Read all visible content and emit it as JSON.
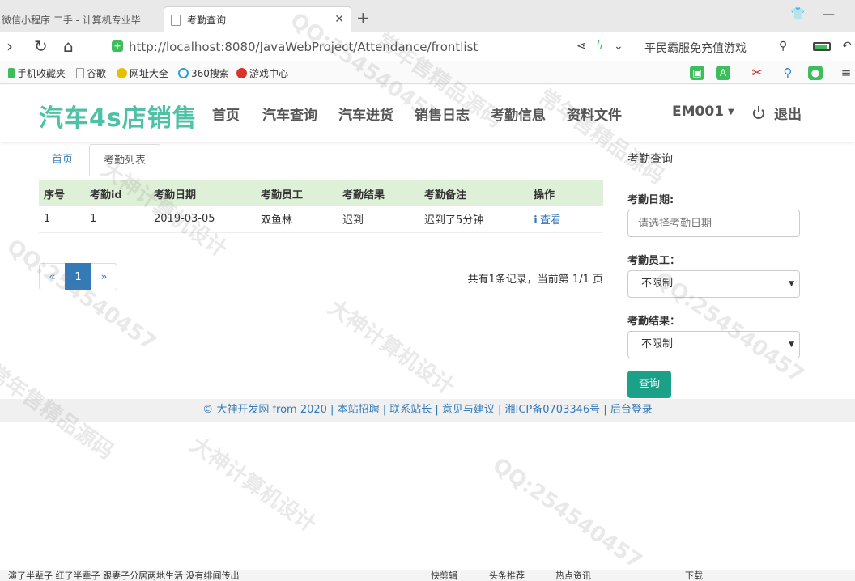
{
  "browser": {
    "tabs": [
      {
        "title": "微信小程序 二手 - 计算机专业毕",
        "active": false
      },
      {
        "title": "考勤查询",
        "active": true
      }
    ],
    "url_host": "http://localhost",
    "url_path": ":8080/JavaWebProject/Attendance/frontlist",
    "addr_promo": "平民霸服免充值游戏",
    "bookmarks": [
      "手机收藏夹",
      "谷歌",
      "网址大全",
      "360搜索",
      "游戏中心"
    ]
  },
  "site": {
    "logo": "汽车4s店销售",
    "nav": [
      "首页",
      "汽车查询",
      "汽车进货",
      "销售日志",
      "考勤信息",
      "资料文件"
    ],
    "user": "EM001",
    "logout": "退出"
  },
  "crumbs": {
    "home": "首页",
    "current": "考勤列表"
  },
  "table": {
    "headers": [
      "序号",
      "考勤id",
      "考勤日期",
      "考勤员工",
      "考勤结果",
      "考勤备注",
      "操作"
    ],
    "rows": [
      {
        "no": "1",
        "id": "1",
        "date": "2019-03-05",
        "employee": "双鱼林",
        "result": "迟到",
        "remark": "迟到了5分钟",
        "action": "查看"
      }
    ]
  },
  "pager": {
    "prev": "«",
    "page": "1",
    "next": "»",
    "info": "共有1条记录，当前第 1/1 页"
  },
  "search": {
    "title": "考勤查询",
    "date_label": "考勤日期:",
    "date_placeholder": "请选择考勤日期",
    "employee_label": "考勤员工：",
    "employee_value": "不限制",
    "result_label": "考勤结果：",
    "result_value": "不限制",
    "submit": "查询"
  },
  "footer": "© 大神开发网 from 2020 | 本站招聘 | 联系站长 | 意见与建议 | 湘ICP备0703346号 | 后台登录",
  "watermarks": [
    "QQ:254540457",
    "常年售精品源码",
    "大神计算机设计",
    "QQ:254540457",
    "常年售精品源码",
    "大神计算机设计",
    "QQ:254540457",
    "常年售精品源码",
    "QQ:254540457",
    "大神计算机设计"
  ],
  "statusbar": {
    "news": "演了半辈子 红了半辈子 跟妻子分居两地生活 没有绯闻传出",
    "items": [
      "快剪辑",
      "头条推荐",
      "热点资讯",
      "下载"
    ]
  },
  "colors": {
    "brand": "#4fc1a6",
    "link": "#337ab7",
    "table_head": "#dff0d8",
    "button": "#1aa188"
  }
}
